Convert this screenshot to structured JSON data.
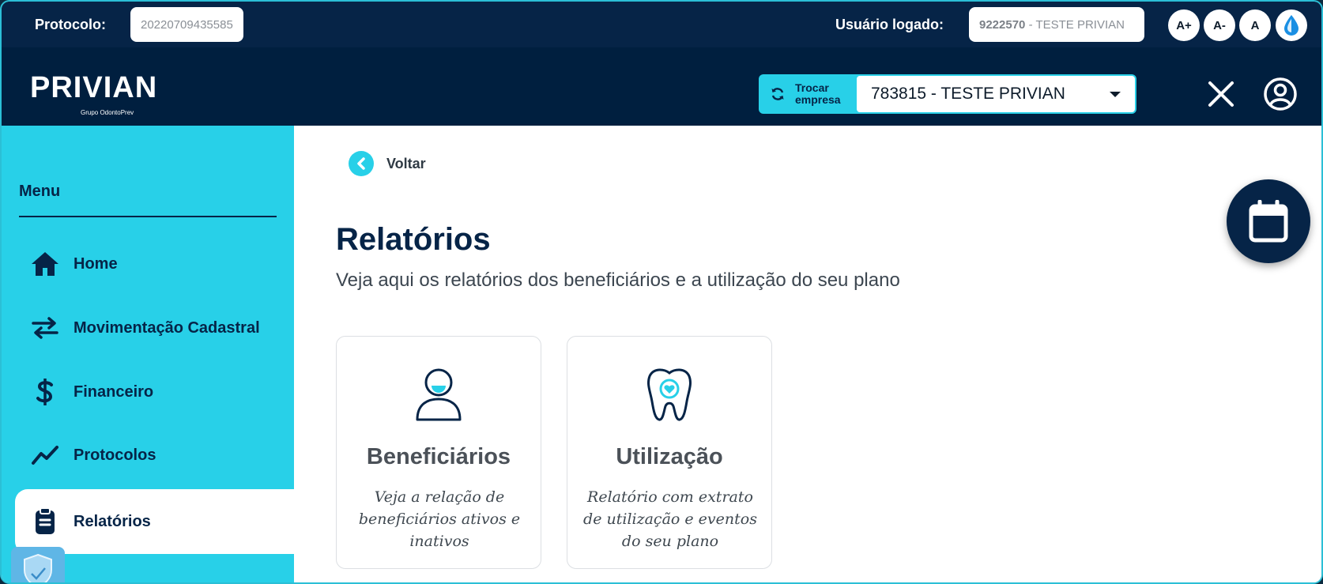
{
  "header": {
    "protocol_label": "Protocolo:",
    "protocol_value": "20220709435585",
    "user_label": "Usuário logado:",
    "user_code": "9222570",
    "user_name": " - TESTE PRIVIAN",
    "font_buttons": [
      "A+",
      "A-",
      "A"
    ],
    "contrast_icon": "drop-icon",
    "logo_text": "PRIVIAN",
    "logo_sub": "Grupo OdontoPrev",
    "switch_company_label_1": "Trocar",
    "switch_company_label_2": "empresa",
    "company_selected": "783815 - TESTE PRIVIAN",
    "close_icon": "close-icon",
    "user_icon": "user-circle-icon"
  },
  "sidebar": {
    "menu_title": "Menu",
    "items": [
      {
        "label": "Home",
        "icon": "home-icon"
      },
      {
        "label": "Movimentação Cadastral",
        "icon": "arrows-icon"
      },
      {
        "label": "Financeiro",
        "icon": "dollar-icon"
      },
      {
        "label": "Protocolos",
        "icon": "chart-line-icon"
      },
      {
        "label": "Relatórios",
        "icon": "report-icon",
        "active": true
      }
    ]
  },
  "main": {
    "back_label": "Voltar",
    "title": "Relatórios",
    "subtitle": "Veja aqui os relatórios dos beneficiários e a utilização do seu plano",
    "cards": [
      {
        "title": "Beneficiários",
        "description": "Veja a relação de beneficiários ativos e inativos",
        "icon": "person-icon"
      },
      {
        "title": "Utilização",
        "description": "Relatório com extrato de utilização e eventos do seu plano",
        "icon": "tooth-icon"
      }
    ]
  },
  "colors": {
    "navy": "#062447",
    "cyan": "#28d0e8",
    "white": "#ffffff"
  }
}
